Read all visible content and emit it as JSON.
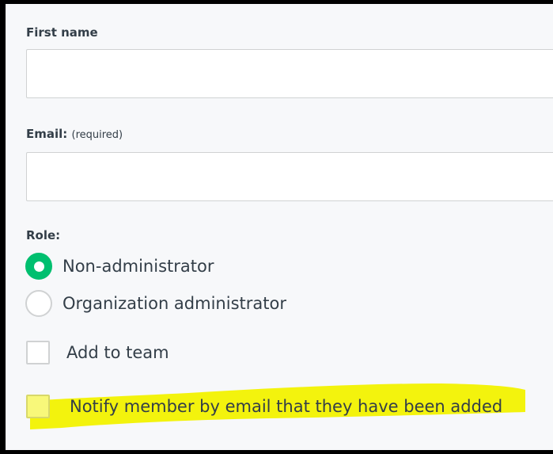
{
  "form": {
    "first_name": {
      "label": "First name",
      "value": ""
    },
    "email": {
      "label": "Email:",
      "hint": "(required)",
      "value": ""
    },
    "role": {
      "label": "Role:",
      "options": [
        {
          "label": "Non-administrator",
          "selected": true
        },
        {
          "label": "Organization administrator",
          "selected": false
        }
      ]
    },
    "add_to_team": {
      "label": "Add to team",
      "checked": false
    },
    "notify_member": {
      "label": "Notify member by email that they have been added",
      "checked": false,
      "highlighted": true
    }
  },
  "colors": {
    "accent_green": "#00bf6f",
    "highlight_yellow": "#f2f200",
    "text": "#333e48",
    "border": "#d0d2d3",
    "panel_background": "#f7f8fa"
  }
}
